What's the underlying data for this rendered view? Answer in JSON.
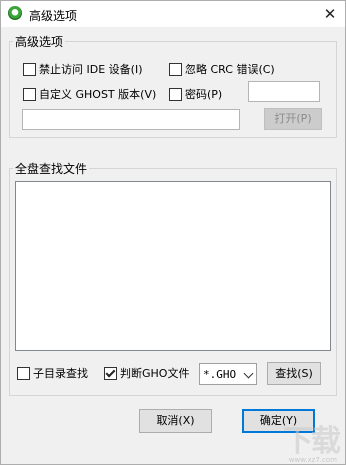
{
  "window": {
    "title": "高级选项",
    "close_glyph": "✕"
  },
  "advanced_group": {
    "label": "高级选项",
    "disable_ide": "禁止访问 IDE 设备(I)",
    "ignore_crc": "忽略 CRC 错误(C)",
    "custom_ghost": "自定义 GHOST 版本(V)",
    "password": "密码(P)",
    "password_value": "",
    "path_value": "",
    "open_button": "打开(P)"
  },
  "search_group": {
    "label": "全盘查找文件",
    "subdir_search": "子目录查找",
    "judge_gho": "判断GHO文件",
    "filter_value": "*.GHO",
    "search_button": "查找(S)"
  },
  "footer": {
    "cancel_button": "取消(X)",
    "ok_button": "确定(Y)"
  },
  "checkbox_states": {
    "disable_ide": false,
    "ignore_crc": false,
    "custom_ghost": false,
    "password": false,
    "subdir_search": false,
    "judge_gho": true
  },
  "watermark": {
    "text": "下载",
    "sub": "www.xz7.com"
  },
  "icons": {
    "app": "app-circle-icon",
    "close": "close-icon",
    "dropdown": "chevron-down-icon"
  }
}
